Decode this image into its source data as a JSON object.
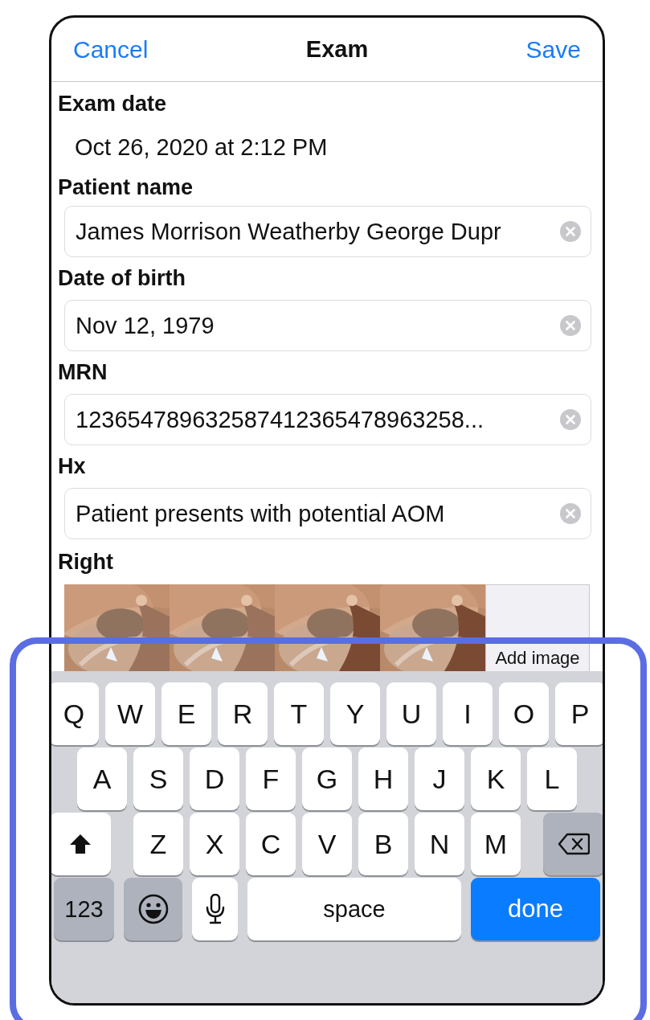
{
  "header": {
    "cancel": "Cancel",
    "title": "Exam",
    "save": "Save"
  },
  "exam_date": {
    "label": "Exam date",
    "value": "Oct 26, 2020 at 2:12 PM"
  },
  "fields": [
    {
      "label": "Patient name",
      "value": "James Morrison Weatherby George Dupr"
    },
    {
      "label": "Date of birth",
      "value": "Nov 12, 1979"
    },
    {
      "label": "MRN",
      "value": "123654789632587412365478963258..."
    },
    {
      "label": "Hx",
      "value": "Patient presents with potential AOM"
    }
  ],
  "images": {
    "label": "Right",
    "add_label": "Add image"
  },
  "keyboard": {
    "letter_rows": [
      [
        "Q",
        "W",
        "E",
        "R",
        "T",
        "Y",
        "U",
        "I",
        "O",
        "P"
      ],
      [
        "A",
        "S",
        "D",
        "F",
        "G",
        "H",
        "J",
        "K",
        "L"
      ],
      [
        "Z",
        "X",
        "C",
        "V",
        "B",
        "N",
        "M"
      ]
    ],
    "numbers_key": "123",
    "space_key": "space",
    "return_key": "done"
  }
}
